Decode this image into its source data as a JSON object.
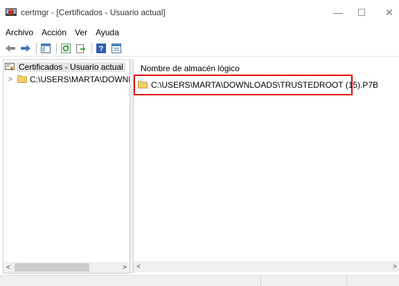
{
  "window": {
    "title": "certmgr - [Certificados - Usuario actual]",
    "minimize_glyph": "—",
    "maximize_glyph": "☐",
    "close_glyph": "✕"
  },
  "menubar": {
    "items": [
      "Archivo",
      "Acción",
      "Ver",
      "Ayuda"
    ]
  },
  "toolbar": {
    "icons": [
      "back-arrow-icon",
      "forward-arrow-icon",
      "show-hide-tree-icon",
      "refresh-icon",
      "export-list-icon",
      "help-icon",
      "properties-icon"
    ]
  },
  "tree": {
    "root_label": "Certificados - Usuario actual",
    "child_label": "C:\\USERS\\MARTA\\DOWNLOA",
    "expand_glyph": ">"
  },
  "list": {
    "column_header": "Nombre de almacén lógico",
    "items": [
      {
        "label": "C:\\USERS\\MARTA\\DOWNLOADS\\TRUSTEDROOT (15).P7B",
        "highlighted": true
      }
    ]
  },
  "scroll": {
    "left_arrow": "<",
    "right_arrow": ">"
  },
  "colors": {
    "highlight_border": "#e00000",
    "folder_yellow": "#f3cf6a"
  }
}
